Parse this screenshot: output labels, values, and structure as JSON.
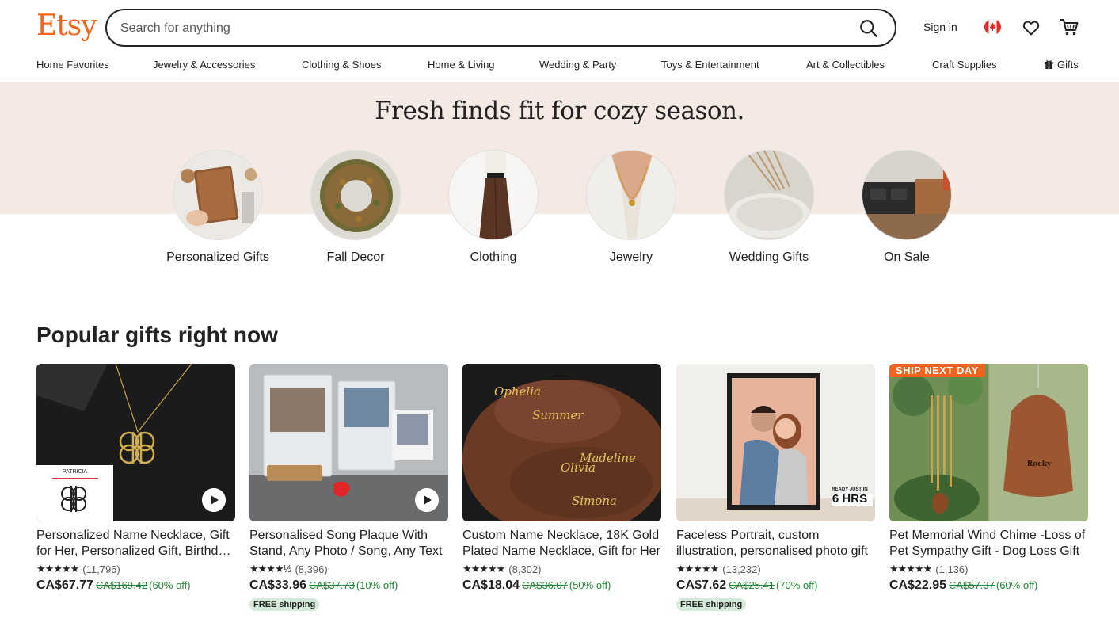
{
  "header": {
    "logo": "Etsy",
    "search_placeholder": "Search for anything",
    "signin": "Sign in"
  },
  "nav": [
    "Home Favorites",
    "Jewelry & Accessories",
    "Clothing & Shoes",
    "Home & Living",
    "Wedding & Party",
    "Toys & Entertainment",
    "Art & Collectibles",
    "Craft Supplies",
    "Gifts"
  ],
  "hero": {
    "title": "Fresh finds fit for cozy season.",
    "categories": [
      "Personalized Gifts",
      "Fall Decor",
      "Clothing",
      "Jewelry",
      "Wedding Gifts",
      "On Sale"
    ]
  },
  "popular": {
    "title": "Popular gifts right now",
    "items": [
      {
        "title": "Personalized Name Necklace, Gift for Her, Personalized Gift, Birthday Gift",
        "reviews": "(11,796)",
        "price": "CA$67.77",
        "orig": "CA$169.42",
        "off": "(60% off)",
        "free_shipping": "",
        "thumb_text": "PATRICIA"
      },
      {
        "title": "Personalised Song Plaque With Stand, Any Photo / Song, Any Text",
        "reviews": "(8,396)",
        "price": "CA$33.96",
        "orig": "CA$37.73",
        "off": "(10% off)",
        "free_shipping": "FREE shipping"
      },
      {
        "title": "Custom Name Necklace, 18K Gold Plated Name Necklace, Gift for Her",
        "reviews": "(8,302)",
        "price": "CA$18.04",
        "orig": "CA$36.07",
        "off": "(50% off)",
        "free_shipping": "",
        "thumb_names": [
          "Ophelia",
          "Summer",
          "Madeline",
          "Olivia",
          "Simona"
        ]
      },
      {
        "title": "Faceless Portrait, custom illustration, personalised photo gift",
        "reviews": "(13,232)",
        "price": "CA$7.62",
        "orig": "CA$25.41",
        "off": "(70% off)",
        "free_shipping": "FREE shipping",
        "thumb_badge_top": "READY JUST IN",
        "thumb_badge_big": "6 HRS"
      },
      {
        "title": "Pet Memorial Wind Chime -Loss of Pet Sympathy Gift - Dog Loss Gift",
        "reviews": "(1,136)",
        "price": "CA$22.95",
        "orig": "CA$57.37",
        "off": "(60% off)",
        "free_shipping": "",
        "badge": "SHIP NEXT DAY",
        "thumb_text": "Rocky"
      }
    ]
  },
  "icons": [
    "search-icon",
    "canada-flag-icon",
    "heart-icon",
    "cart-icon",
    "gift-icon",
    "play-icon",
    "star-icon"
  ],
  "colors": {
    "brand": "#f1641e",
    "hero_bg": "#f5e9e4",
    "discount": "#258635",
    "free_shipping_bg": "#d4e9d7"
  }
}
